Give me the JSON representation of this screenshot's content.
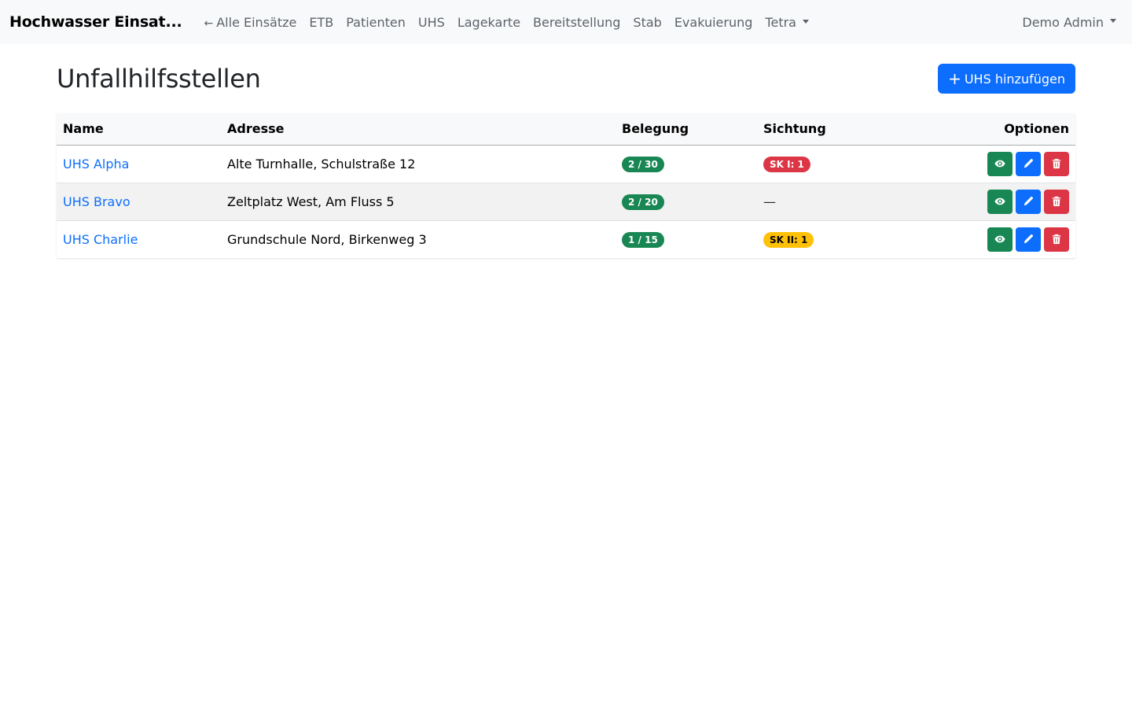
{
  "navbar": {
    "brand": "Hochwasser Einsat...",
    "back_arrow": "←",
    "links": [
      {
        "label": "Alle Einsätze"
      },
      {
        "label": "ETB"
      },
      {
        "label": "Patienten"
      },
      {
        "label": "UHS"
      },
      {
        "label": "Lagekarte"
      },
      {
        "label": "Bereitstellung"
      },
      {
        "label": "Stab"
      },
      {
        "label": "Evakuierung"
      },
      {
        "label": "Tetra"
      }
    ],
    "user": "Demo Admin"
  },
  "page": {
    "title": "Unfallhilfsstellen",
    "add_button": {
      "icon": "+",
      "label": "UHS hinzufügen"
    }
  },
  "table": {
    "headers": {
      "name": "Name",
      "address": "Adresse",
      "occupancy": "Belegung",
      "triage": "Sichtung",
      "options": "Optionen"
    },
    "rows": [
      {
        "name": "UHS Alpha",
        "address": "Alte Turnhalle, Schulstraße 12",
        "occupancy": "2 / 30",
        "triage": "SK I: 1",
        "triage_color": "#dc3545"
      },
      {
        "name": "UHS Bravo",
        "address": "Zeltplatz West, Am Fluss 5",
        "occupancy": "2 / 20",
        "triage": "—",
        "triage_color": ""
      },
      {
        "name": "UHS Charlie",
        "address": "Grundschule Nord, Birkenweg 3",
        "occupancy": "1 / 15",
        "triage": "SK II: 1",
        "triage_color": "#ffc107"
      }
    ]
  },
  "colors": {
    "primary": "#0d6efd",
    "success": "#198754",
    "danger": "#dc3545",
    "warning": "#ffc107",
    "navbar_bg": "#f8f9fa"
  },
  "icons": {
    "view": "eye-icon",
    "edit": "pencil-icon",
    "delete": "trash-icon"
  }
}
